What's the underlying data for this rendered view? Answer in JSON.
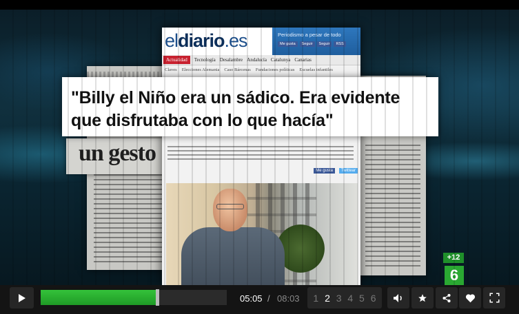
{
  "video": {
    "webpage": {
      "logo_prefix": "el",
      "logo_main": "diario",
      "logo_suffix": ".es",
      "tagline": "Periodismo a pesar de todo",
      "social": [
        "Me gusta",
        "Seguir",
        "Seguir",
        "RSS"
      ],
      "nav": [
        "Actualidad",
        "Tecnología",
        "Desalambre",
        "Andalucía",
        "Catalunya",
        "Canarias"
      ],
      "subnav": [
        "Claves",
        "Elecciones Alemania",
        "Caso Bárcenas",
        "Fundaciones políticas",
        "Escuelas infantiles"
      ],
      "meta": [
        "Me gusta",
        "Twittear"
      ]
    },
    "clipping_headline": "un gesto",
    "quote": "\"Billy el Niño era un sádico. Era evidente que disfrutaba con lo que hacía\"",
    "rating": "+12",
    "channel_logo": "6"
  },
  "controls": {
    "current_time": "05:05",
    "separator": "/",
    "total_time": "08:03",
    "progress": 0.625,
    "pages": [
      "1",
      "2",
      "3",
      "4",
      "5",
      "6"
    ],
    "current_page": "2",
    "icons": {
      "play": "play-icon",
      "volume": "volume-icon",
      "favorite": "star-icon",
      "share": "share-icon",
      "like": "heart-icon",
      "fullscreen": "fullscreen-icon"
    }
  }
}
